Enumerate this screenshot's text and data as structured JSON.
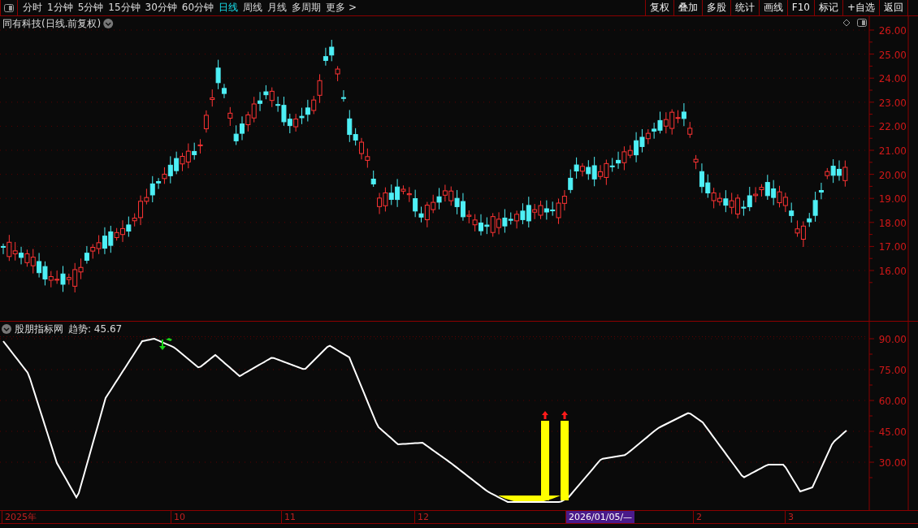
{
  "toolbar": {
    "periods": [
      {
        "label": "分时",
        "selected": false
      },
      {
        "label": "1分钟",
        "selected": false
      },
      {
        "label": "5分钟",
        "selected": false
      },
      {
        "label": "15分钟",
        "selected": false
      },
      {
        "label": "30分钟",
        "selected": false
      },
      {
        "label": "60分钟",
        "selected": false
      },
      {
        "label": "日线",
        "selected": true
      },
      {
        "label": "周线",
        "selected": false
      },
      {
        "label": "月线",
        "selected": false
      },
      {
        "label": "多周期",
        "selected": false
      },
      {
        "label": "更多 >",
        "selected": false
      }
    ],
    "actions": [
      "复权",
      "叠加",
      "多股",
      "统计",
      "画线",
      "F10",
      "标记",
      "+自选",
      "返回"
    ]
  },
  "main_chart": {
    "title": "同有科技(日线.前复权)",
    "y_labels": [
      "26.00",
      "25.00",
      "24.00",
      "23.00",
      "22.00",
      "21.00",
      "20.00",
      "19.00",
      "18.00",
      "17.00",
      "16.00"
    ]
  },
  "indicator": {
    "name": "股朋指标网",
    "reading": "趋势: 45.67",
    "y_labels": [
      "90.00",
      "75.00",
      "60.00",
      "45.00",
      "30.00"
    ]
  },
  "time_axis": {
    "labels": [
      {
        "label": "2025年",
        "selected": false
      },
      {
        "label": "10",
        "selected": false
      },
      {
        "label": "11",
        "selected": false
      },
      {
        "label": "12",
        "selected": false
      },
      {
        "label": "2026/01/05/—",
        "selected": true
      },
      {
        "label": "2",
        "selected": false
      },
      {
        "label": "3",
        "selected": false
      }
    ]
  }
}
